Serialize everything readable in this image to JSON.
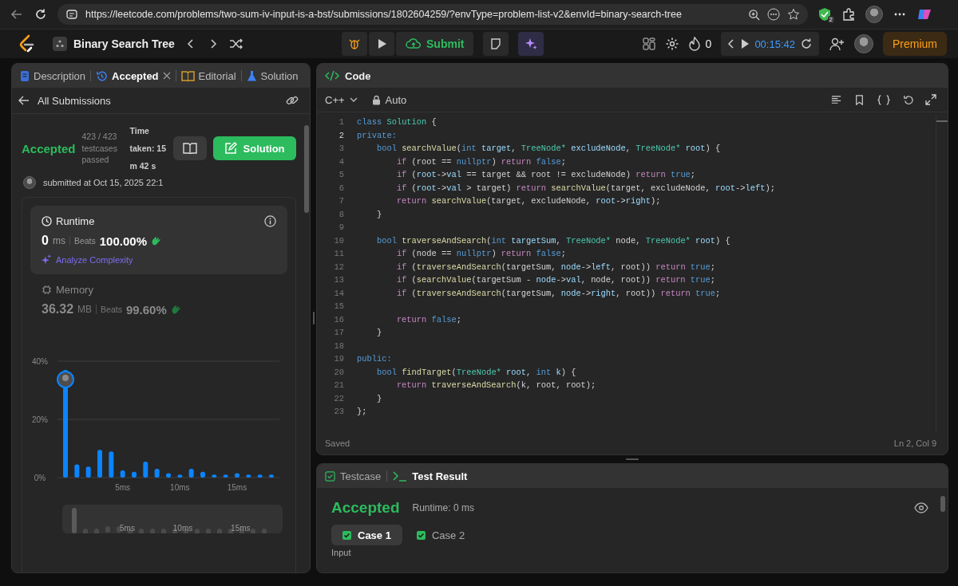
{
  "browser": {
    "url": "https://leetcode.com/problems/two-sum-iv-input-is-a-bst/submissions/1802604259/?envType=problem-list-v2&envId=binary-search-tree",
    "extension_badge": "2"
  },
  "nav": {
    "problem_list": "Binary Search Tree",
    "submit": "Submit",
    "streak": "0",
    "timer": "00:15:42",
    "premium": "Premium"
  },
  "left_tabs": [
    {
      "label": "Description",
      "kind": "description",
      "selected": false
    },
    {
      "label": "Accepted",
      "kind": "submission",
      "selected": true
    },
    {
      "label": "Editorial",
      "kind": "editorial",
      "selected": false
    },
    {
      "label": "Solution",
      "kind": "solutions",
      "selected": false
    }
  ],
  "back_link": "All Submissions",
  "result": {
    "status": "Accepted",
    "testcases": "423 / 423 testcases passed",
    "time_taken": "Time taken: 15 m 42 s",
    "solution_button": "Solution",
    "submitted": "submitted at Oct 15, 2025 22:1"
  },
  "metrics": [
    {
      "kind": "runtime",
      "title": "Runtime",
      "value": "0",
      "unit": "ms",
      "beats_label": "Beats",
      "beats": "100.00%",
      "link": "Analyze Complexity",
      "selected": true
    },
    {
      "kind": "memory",
      "title": "Memory",
      "value": "36.32",
      "unit": "MB",
      "beats_label": "Beats",
      "beats": "99.60%",
      "selected": false
    }
  ],
  "chart_data": {
    "type": "bar",
    "x": [
      0,
      1,
      2,
      3,
      4,
      5,
      6,
      7,
      8,
      9,
      10,
      11,
      12,
      13,
      14,
      15,
      16,
      17,
      18
    ],
    "values": [
      37,
      4.5,
      3.8,
      9.5,
      9,
      2.5,
      2,
      5.5,
      3,
      1.5,
      1,
      3,
      2,
      1,
      1,
      1.5,
      1,
      1,
      1
    ],
    "xlim": [
      -0.7,
      18.7
    ],
    "ylim": [
      0,
      40
    ],
    "yticks": [
      {
        "value": 0,
        "label": "0%"
      },
      {
        "value": 20,
        "label": "20%"
      },
      {
        "value": 40,
        "label": "40%"
      }
    ],
    "xticks": [
      {
        "value": 5,
        "label": "5ms"
      },
      {
        "value": 10,
        "label": "10ms"
      },
      {
        "value": 15,
        "label": "15ms"
      }
    ]
  },
  "overview_labels": [
    "5ms",
    "10ms",
    "15ms"
  ],
  "code": {
    "title": "Code",
    "language": "C++",
    "mode": "Auto",
    "status": "Saved",
    "cursor": "Ln 2, Col 9",
    "lines": [
      {
        "number": "1",
        "current": false,
        "tokens": [
          {
            "kind": "keyword",
            "text": "class"
          },
          {
            "kind": "type",
            "text": " Solution"
          },
          {
            "kind": "plain",
            "text": " {"
          }
        ]
      },
      {
        "number": "2",
        "current": true,
        "tokens": [
          {
            "kind": "keyword",
            "text": "private:"
          }
        ]
      },
      {
        "number": "3",
        "current": false,
        "tokens": [
          {
            "kind": "keyword",
            "text": "    bool"
          },
          {
            "kind": "function",
            "text": " searchValue"
          },
          {
            "kind": "plain",
            "text": "("
          },
          {
            "kind": "keyword",
            "text": "int"
          },
          {
            "kind": "variable",
            "text": " target"
          },
          {
            "kind": "plain",
            "text": ", "
          },
          {
            "kind": "type",
            "text": "TreeNode*"
          },
          {
            "kind": "variable",
            "text": " excludeNode"
          },
          {
            "kind": "plain",
            "text": ", "
          },
          {
            "kind": "type",
            "text": "TreeNode*"
          },
          {
            "kind": "variable",
            "text": " root"
          },
          {
            "kind": "plain",
            "text": ") {"
          }
        ]
      },
      {
        "number": "4",
        "current": false,
        "tokens": [
          {
            "kind": "control",
            "text": "        if"
          },
          {
            "kind": "plain",
            "text": " (root == "
          },
          {
            "kind": "keyword",
            "text": "nullptr"
          },
          {
            "kind": "plain",
            "text": ") "
          },
          {
            "kind": "control",
            "text": "return"
          },
          {
            "kind": "keyword",
            "text": " false"
          },
          {
            "kind": "plain",
            "text": ";"
          }
        ]
      },
      {
        "number": "5",
        "current": false,
        "tokens": [
          {
            "kind": "control",
            "text": "        if"
          },
          {
            "kind": "plain",
            "text": " ("
          },
          {
            "kind": "variable",
            "text": "root"
          },
          {
            "kind": "plain",
            "text": "->"
          },
          {
            "kind": "variable",
            "text": "val"
          },
          {
            "kind": "plain",
            "text": " == target && root != excludeNode) "
          },
          {
            "kind": "control",
            "text": "return"
          },
          {
            "kind": "keyword",
            "text": " true"
          },
          {
            "kind": "plain",
            "text": ";"
          }
        ]
      },
      {
        "number": "6",
        "current": false,
        "tokens": [
          {
            "kind": "control",
            "text": "        if"
          },
          {
            "kind": "plain",
            "text": " ("
          },
          {
            "kind": "variable",
            "text": "root"
          },
          {
            "kind": "plain",
            "text": "->"
          },
          {
            "kind": "variable",
            "text": "val"
          },
          {
            "kind": "plain",
            "text": " > target) "
          },
          {
            "kind": "control",
            "text": "return"
          },
          {
            "kind": "function",
            "text": " searchValue"
          },
          {
            "kind": "plain",
            "text": "(target, excludeNode, "
          },
          {
            "kind": "variable",
            "text": "root"
          },
          {
            "kind": "plain",
            "text": "->"
          },
          {
            "kind": "variable",
            "text": "left"
          },
          {
            "kind": "plain",
            "text": ");"
          }
        ]
      },
      {
        "number": "7",
        "current": false,
        "tokens": [
          {
            "kind": "control",
            "text": "        return"
          },
          {
            "kind": "function",
            "text": " searchValue"
          },
          {
            "kind": "plain",
            "text": "(target, excludeNode, "
          },
          {
            "kind": "variable",
            "text": "root"
          },
          {
            "kind": "plain",
            "text": "->"
          },
          {
            "kind": "variable",
            "text": "right"
          },
          {
            "kind": "plain",
            "text": ");"
          }
        ]
      },
      {
        "number": "8",
        "current": false,
        "tokens": [
          {
            "kind": "plain",
            "text": "    }"
          }
        ]
      },
      {
        "number": "9",
        "current": false
      },
      {
        "number": "10",
        "current": false,
        "tokens": [
          {
            "kind": "keyword",
            "text": "    bool"
          },
          {
            "kind": "function",
            "text": " traverseAndSearch"
          },
          {
            "kind": "plain",
            "text": "("
          },
          {
            "kind": "keyword",
            "text": "int"
          },
          {
            "kind": "variable",
            "text": " targetSum"
          },
          {
            "kind": "plain",
            "text": ", "
          },
          {
            "kind": "type",
            "text": "TreeNode*"
          },
          {
            "kind": "plain",
            "text": " node, "
          },
          {
            "kind": "type",
            "text": "TreeNode*"
          },
          {
            "kind": "variable",
            "text": " root"
          },
          {
            "kind": "plain",
            "text": ") {"
          }
        ]
      },
      {
        "number": "11",
        "current": false,
        "tokens": [
          {
            "kind": "control",
            "text": "        if"
          },
          {
            "kind": "plain",
            "text": " (node == "
          },
          {
            "kind": "keyword",
            "text": "nullptr"
          },
          {
            "kind": "plain",
            "text": ") "
          },
          {
            "kind": "control",
            "text": "return"
          },
          {
            "kind": "keyword",
            "text": " false"
          },
          {
            "kind": "plain",
            "text": ";"
          }
        ]
      },
      {
        "number": "12",
        "current": false,
        "tokens": [
          {
            "kind": "control",
            "text": "        if"
          },
          {
            "kind": "plain",
            "text": " ("
          },
          {
            "kind": "function",
            "text": "traverseAndSearch"
          },
          {
            "kind": "plain",
            "text": "(targetSum, "
          },
          {
            "kind": "variable",
            "text": "node"
          },
          {
            "kind": "plain",
            "text": "->"
          },
          {
            "kind": "variable",
            "text": "left"
          },
          {
            "kind": "plain",
            "text": ", root)) "
          },
          {
            "kind": "control",
            "text": "return"
          },
          {
            "kind": "keyword",
            "text": " true"
          },
          {
            "kind": "plain",
            "text": ";"
          }
        ]
      },
      {
        "number": "13",
        "current": false,
        "tokens": [
          {
            "kind": "control",
            "text": "        if"
          },
          {
            "kind": "plain",
            "text": " ("
          },
          {
            "kind": "function",
            "text": "searchValue"
          },
          {
            "kind": "plain",
            "text": "(targetSum - "
          },
          {
            "kind": "variable",
            "text": "node"
          },
          {
            "kind": "plain",
            "text": "->"
          },
          {
            "kind": "variable",
            "text": "val"
          },
          {
            "kind": "plain",
            "text": ", node, root)) "
          },
          {
            "kind": "control",
            "text": "return"
          },
          {
            "kind": "keyword",
            "text": " true"
          },
          {
            "kind": "plain",
            "text": ";"
          }
        ]
      },
      {
        "number": "14",
        "current": false,
        "tokens": [
          {
            "kind": "control",
            "text": "        if"
          },
          {
            "kind": "plain",
            "text": " ("
          },
          {
            "kind": "function",
            "text": "traverseAndSearch"
          },
          {
            "kind": "plain",
            "text": "(targetSum, "
          },
          {
            "kind": "variable",
            "text": "node"
          },
          {
            "kind": "plain",
            "text": "->"
          },
          {
            "kind": "variable",
            "text": "right"
          },
          {
            "kind": "plain",
            "text": ", root)) "
          },
          {
            "kind": "control",
            "text": "return"
          },
          {
            "kind": "keyword",
            "text": " true"
          },
          {
            "kind": "plain",
            "text": ";"
          }
        ]
      },
      {
        "number": "15",
        "current": false
      },
      {
        "number": "16",
        "current": false,
        "tokens": [
          {
            "kind": "control",
            "text": "        return"
          },
          {
            "kind": "keyword",
            "text": " false"
          },
          {
            "kind": "plain",
            "text": ";"
          }
        ]
      },
      {
        "number": "17",
        "current": false,
        "tokens": [
          {
            "kind": "plain",
            "text": "    }"
          }
        ]
      },
      {
        "number": "18",
        "current": false
      },
      {
        "number": "19",
        "current": false,
        "tokens": [
          {
            "kind": "keyword",
            "text": "public:"
          }
        ]
      },
      {
        "number": "20",
        "current": false,
        "tokens": [
          {
            "kind": "keyword",
            "text": "    bool"
          },
          {
            "kind": "function",
            "text": " findTarget"
          },
          {
            "kind": "plain",
            "text": "("
          },
          {
            "kind": "type",
            "text": "TreeNode*"
          },
          {
            "kind": "variable",
            "text": " root"
          },
          {
            "kind": "plain",
            "text": ", "
          },
          {
            "kind": "keyword",
            "text": "int"
          },
          {
            "kind": "variable",
            "text": " k"
          },
          {
            "kind": "plain",
            "text": ") {"
          }
        ]
      },
      {
        "number": "21",
        "current": false,
        "tokens": [
          {
            "kind": "control",
            "text": "        return"
          },
          {
            "kind": "function",
            "text": " traverseAndSearch"
          },
          {
            "kind": "plain",
            "text": "(k, root, root);"
          }
        ]
      },
      {
        "number": "22",
        "current": false,
        "tokens": [
          {
            "kind": "plain",
            "text": "    }"
          }
        ]
      },
      {
        "number": "23",
        "current": false,
        "tokens": [
          {
            "kind": "plain",
            "text": "};"
          }
        ]
      }
    ]
  },
  "test_tabs": [
    {
      "label": "Testcase",
      "kind": "testcase",
      "selected": false
    },
    {
      "label": "Test Result",
      "kind": "result",
      "selected": true
    }
  ],
  "test_result": {
    "status": "Accepted",
    "runtime": "Runtime: 0 ms",
    "section": "Input"
  },
  "cases": [
    {
      "label": "Case 1",
      "selected": true
    },
    {
      "label": "Case 2",
      "selected": false
    }
  ]
}
